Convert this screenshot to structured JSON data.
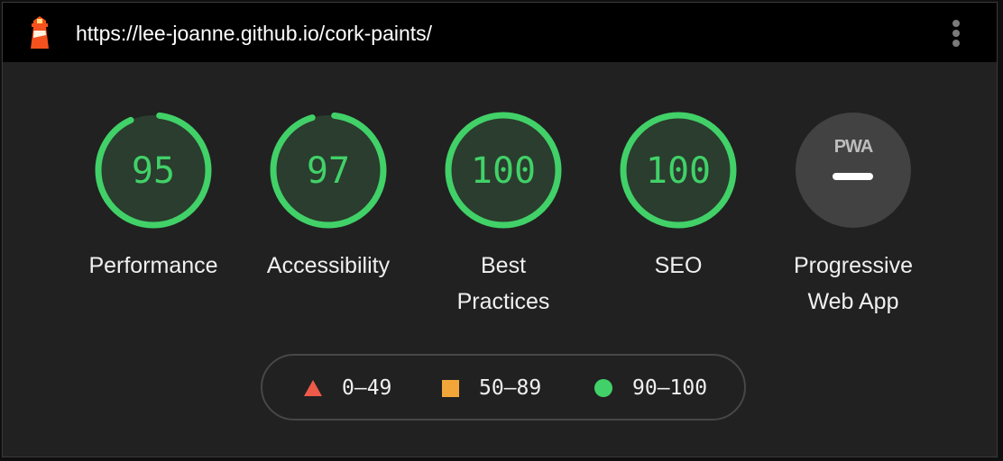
{
  "header": {
    "url": "https://lee-joanne.github.io/cork-paints/",
    "logo_icon": "lighthouse-logo-icon",
    "menu_icon": "more-vertical-icon"
  },
  "colors": {
    "pass": "#41d168",
    "average": "#f2a63a",
    "fail": "#ed5a4a",
    "pwa_bg": "#424242"
  },
  "gauges": [
    {
      "label": "Performance",
      "score": "95",
      "fraction": 0.95
    },
    {
      "label": "Accessibility",
      "score": "97",
      "fraction": 0.97
    },
    {
      "label": "Best\nPractices",
      "score": "100",
      "fraction": 1.0
    },
    {
      "label": "SEO",
      "score": "100",
      "fraction": 1.0
    },
    {
      "label": "Progressive\nWeb App",
      "badge": "PWA",
      "icon": "pwa-dash-icon"
    }
  ],
  "legend": [
    {
      "range": "0–49",
      "icon": "triangle-icon"
    },
    {
      "range": "50–89",
      "icon": "square-icon"
    },
    {
      "range": "90–100",
      "icon": "circle-icon"
    }
  ]
}
